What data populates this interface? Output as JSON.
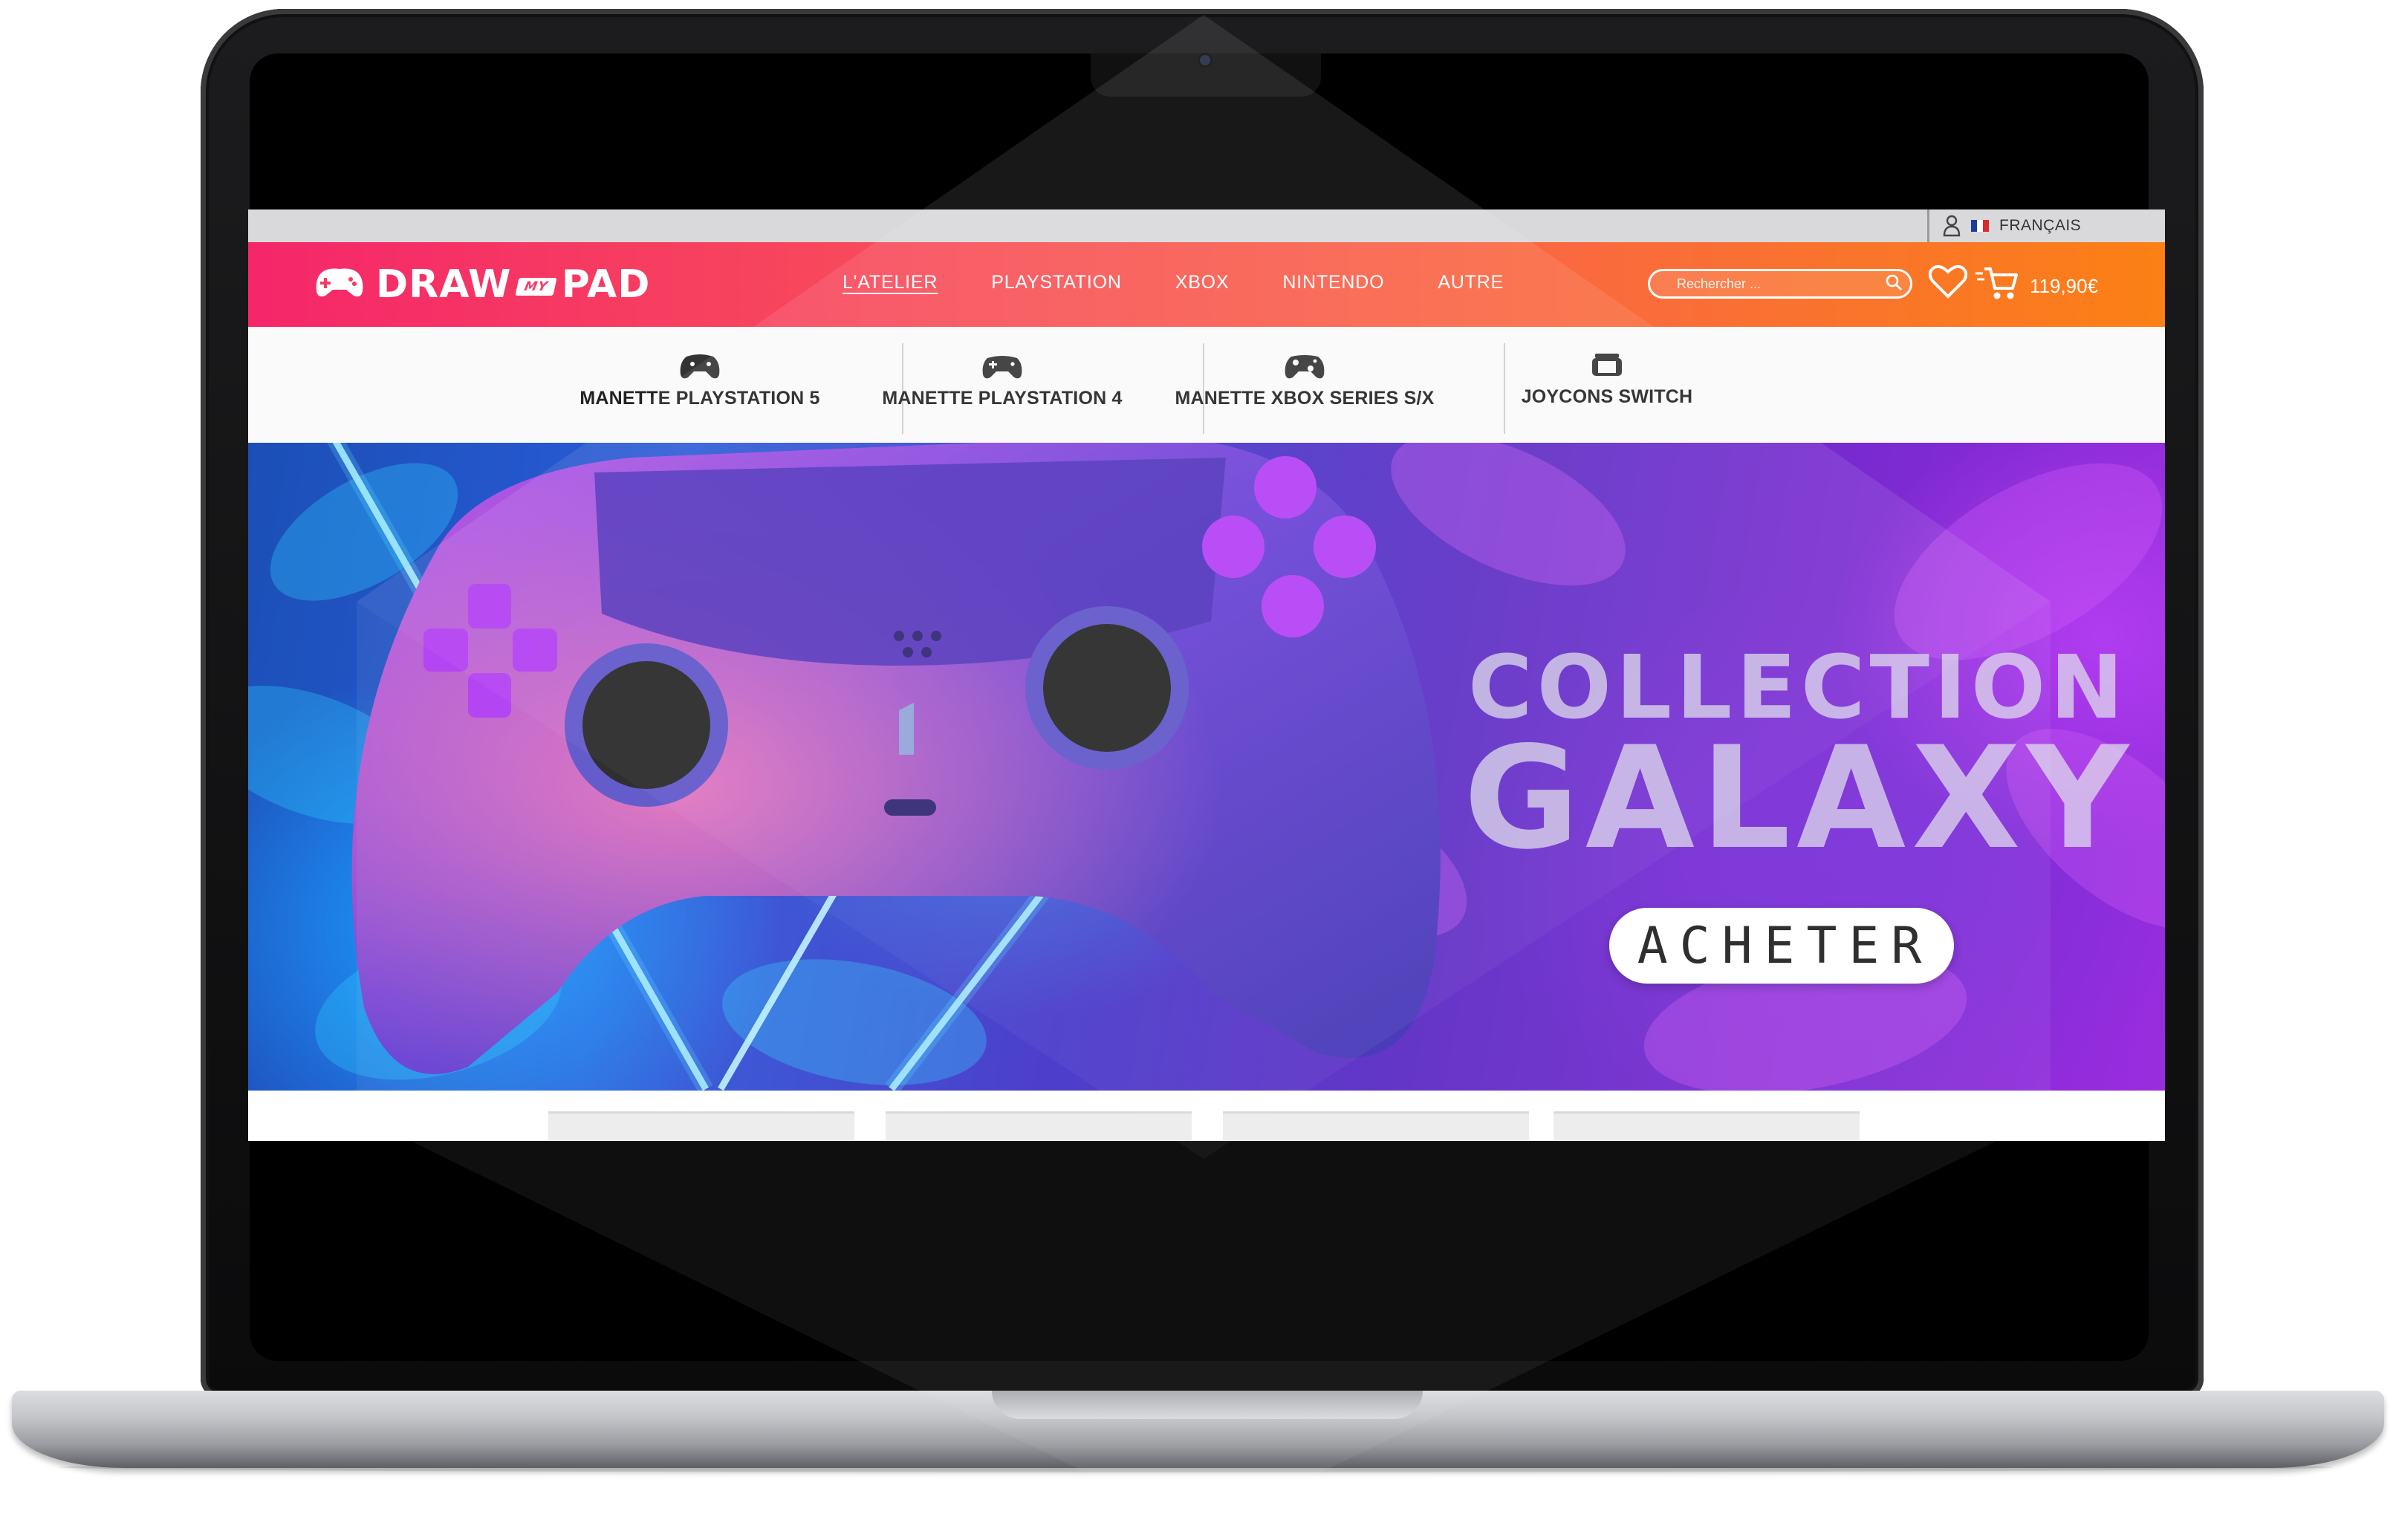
{
  "topbar": {
    "language": "FRANÇAIS",
    "user_icon": "user-icon",
    "flag_icon": "france-flag-icon"
  },
  "header": {
    "logo": {
      "word1": "DRAW",
      "word2": "MY",
      "word3": "PAD",
      "icon": "gamepad-icon"
    },
    "nav": [
      {
        "label": "L'ATELIER",
        "active": true
      },
      {
        "label": "PLAYSTATION",
        "active": false
      },
      {
        "label": "XBOX",
        "active": false
      },
      {
        "label": "NINTENDO",
        "active": false
      },
      {
        "label": "AUTRE",
        "active": false
      }
    ],
    "search": {
      "placeholder": "Rechercher ...",
      "icon": "search-icon"
    },
    "wishlist_icon": "heart-icon",
    "cart_icon": "cart-icon",
    "cart_total": "119,90€"
  },
  "categories": [
    {
      "label": "MANETTE PLAYSTATION 5",
      "icon": "ps5-controller-icon"
    },
    {
      "label": "MANETTE PLAYSTATION 4",
      "icon": "ps4-controller-icon"
    },
    {
      "label": "MANETTE XBOX SERIES S/X",
      "icon": "xbox-controller-icon"
    },
    {
      "label": "JOYCONS SWITCH",
      "icon": "switch-joycons-icon"
    }
  ],
  "hero": {
    "title_line1": "COLLECTION",
    "title_line2": "GALAXY",
    "cta_label": "ACHETER"
  },
  "colors": {
    "header_start": "#f5266a",
    "header_end": "#fb8015",
    "hero_purple": "#7a2ad0",
    "hero_blue": "#1b4fb6"
  }
}
